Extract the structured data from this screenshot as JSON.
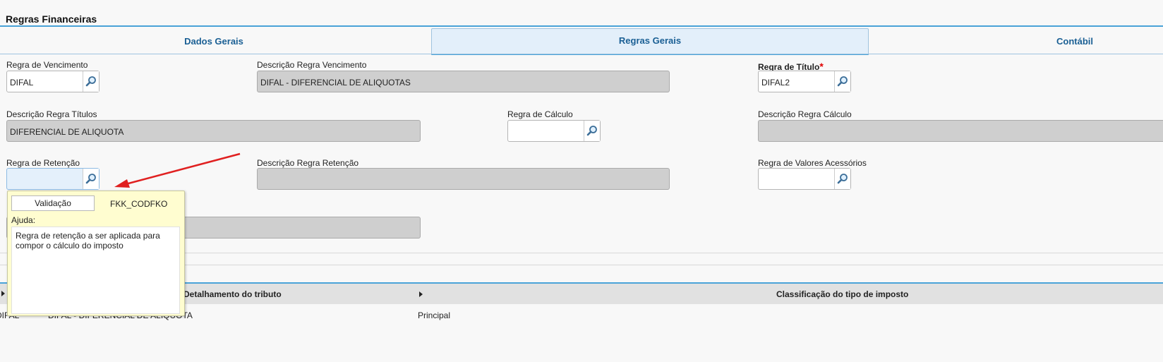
{
  "header": {
    "title": "Regras Financeiras"
  },
  "tabs": [
    {
      "label": "Dados Gerais"
    },
    {
      "label": "Regras Gerais"
    },
    {
      "label": "Contábil"
    }
  ],
  "active_tab": "Regras Gerais",
  "form": {
    "regra_vencimento": {
      "label": "Regra de Vencimento",
      "value": "DIFAL"
    },
    "descricao_regra_vencimento": {
      "label": "Descrição Regra Vencimento",
      "value": "DIFAL - DIFERENCIAL DE ALIQUOTAS"
    },
    "regra_titulo": {
      "label": "Regra de Título",
      "required_mark": "*",
      "value": "DIFAL2"
    },
    "descricao_regra_titulos": {
      "label": "Descrição Regra Títulos",
      "value": "DIFERENCIAL DE ALIQUOTA"
    },
    "regra_calculo": {
      "label": "Regra de Cálculo",
      "value": ""
    },
    "descricao_regra_calculo": {
      "label": "Descrição Regra Cálculo",
      "value": ""
    },
    "regra_retencao": {
      "label": "Regra de Retenção",
      "value": ""
    },
    "descricao_regra_retencao": {
      "label": "Descrição Regra Retenção",
      "value": ""
    },
    "regra_valores_acessorios": {
      "label": "Regra de Valores Acessórios",
      "value": ""
    }
  },
  "tooltip": {
    "button_label": "Validação",
    "field_code": "FKK_CODFKO",
    "help_label": "Ajuda:",
    "help_text": "Regra de retenção a ser aplicada para compor o cálculo do imposto"
  },
  "grid": {
    "columns": [
      "Detalhamento do tributo",
      "Classificação do tipo de imposto"
    ],
    "rows": [
      {
        "col1": "DIFAL",
        "col2": "DIFAL - DIFERENCIAL DE ALIQUOTA",
        "col3": "Principal"
      }
    ]
  },
  "colors": {
    "accent": "#4aa3d8",
    "tab_text": "#1a5f94",
    "annotation_arrow": "#e02020",
    "tooltip_bg": "#fffdd0"
  },
  "icons": {
    "lookup": "magnifier-icon"
  }
}
